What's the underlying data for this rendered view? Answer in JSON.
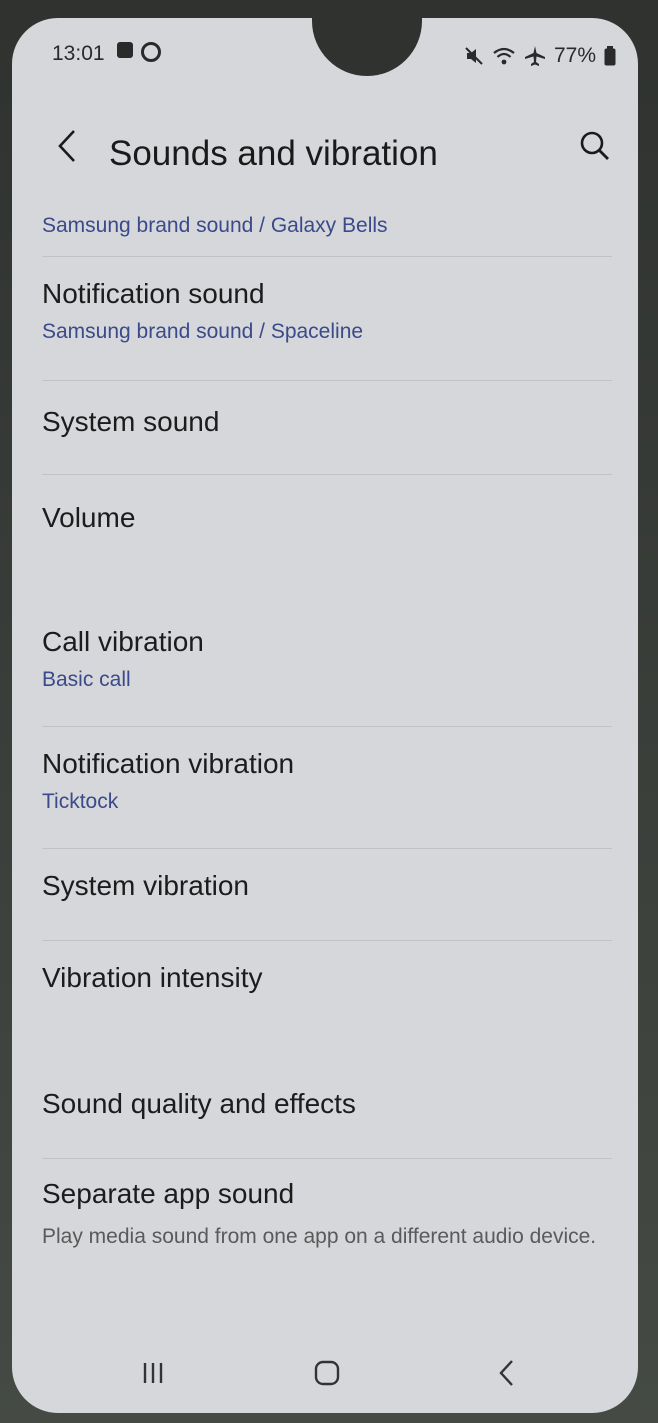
{
  "status": {
    "time": "13:01",
    "battery": "77%",
    "left_icons": [
      "gallery-icon",
      "sync-icon"
    ],
    "right_icons": [
      "mute-icon",
      "wifi-icon",
      "airplane-icon",
      "battery-icon"
    ]
  },
  "header": {
    "title": "Sounds and vibration",
    "back_icon": "chevron-left-icon",
    "search_icon": "search-icon"
  },
  "list": {
    "clipped_subtitle": "Samsung brand sound / Galaxy Bells",
    "items": [
      {
        "title": "Notification sound",
        "subtitle": "Samsung brand sound / Spaceline"
      },
      {
        "title": "System sound"
      },
      {
        "title": "Volume"
      },
      {
        "title": "Call vibration",
        "subtitle": "Basic call"
      },
      {
        "title": "Notification vibration",
        "subtitle": "Ticktock"
      },
      {
        "title": "System vibration"
      },
      {
        "title": "Vibration intensity"
      },
      {
        "title": "Sound quality and effects"
      },
      {
        "title": "Separate app sound",
        "subtitle": "Play media sound from one app on a different audio device."
      }
    ]
  },
  "nav": {
    "recents_icon": "recents-icon",
    "home_icon": "home-icon",
    "back_icon": "back-icon"
  }
}
